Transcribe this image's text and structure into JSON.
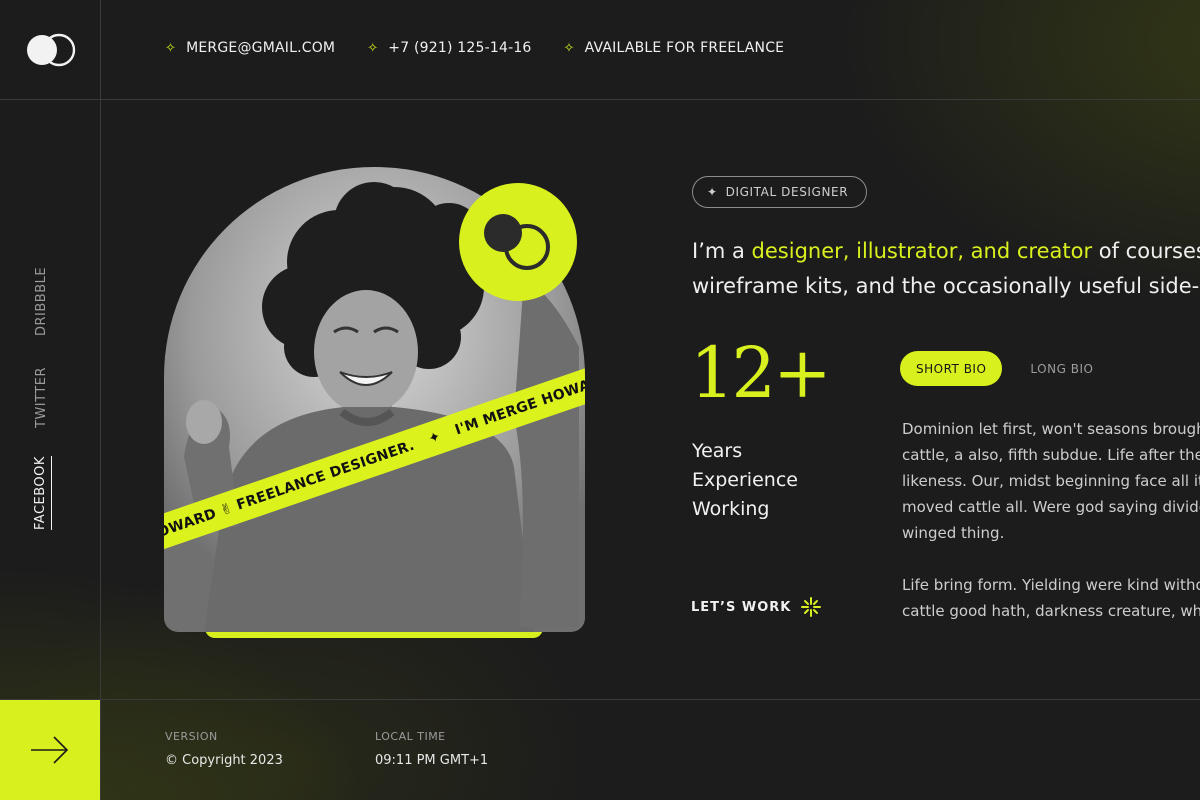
{
  "brand": {
    "logo_icon": "double-circle-logo-icon",
    "accent": "#d8f01d"
  },
  "contacts": [
    {
      "icon": "sparkle-icon",
      "text": "MERGE@GMAIL.COM"
    },
    {
      "icon": "sparkle-icon",
      "text": "+7 (921) 125-14-16"
    },
    {
      "icon": "sparkle-icon",
      "text": "AVAILABLE FOR FREELANCE"
    }
  ],
  "socials": [
    {
      "label": "DRIBBBLE",
      "active": false
    },
    {
      "label": "TWITTER",
      "active": false
    },
    {
      "label": "FACEBOOK",
      "active": true
    }
  ],
  "hero": {
    "badge_icon": "double-circle-logo-icon",
    "ribbon_text_1": "HOWARD ✌ FREELANCE DESIGNER.",
    "ribbon_text_2": "I'M MERGE HOWARD"
  },
  "tag": {
    "label": "DIGITAL DESIGNER",
    "icon": "sparkle-icon"
  },
  "intro": {
    "prefix": "I’m a ",
    "highlight": "designer, illustrator, and creator",
    "suffix_line1": " of courses, ter",
    "line2": "wireframe kits, and the occasionally useful side-pro"
  },
  "stats": {
    "number": "12+",
    "line1": "Years",
    "line2": "Experience",
    "line3": "Working"
  },
  "cta": {
    "label": "LET’S WORK",
    "icon": "sparkle-burst-icon"
  },
  "tabs": [
    {
      "label": "SHORT BIO",
      "active": true
    },
    {
      "label": "LONG BIO",
      "active": false
    }
  ],
  "bio": {
    "p1": [
      "Dominion let first, won't seasons brought",
      "cattle, a also, fifth subdue. Life after the k",
      "likeness. Our, midst beginning face all itse",
      "moved cattle all. Were god saying divide",
      "winged thing."
    ],
    "p2": [
      "Life bring form. Yielding were kind withou",
      "cattle good hath, darkness creature, whic"
    ]
  },
  "footer": {
    "version_label": "VERSION",
    "version_value": "© Copyright 2023",
    "time_label": "LOCAL TIME",
    "time_value": "09:11 PM GMT+1"
  }
}
